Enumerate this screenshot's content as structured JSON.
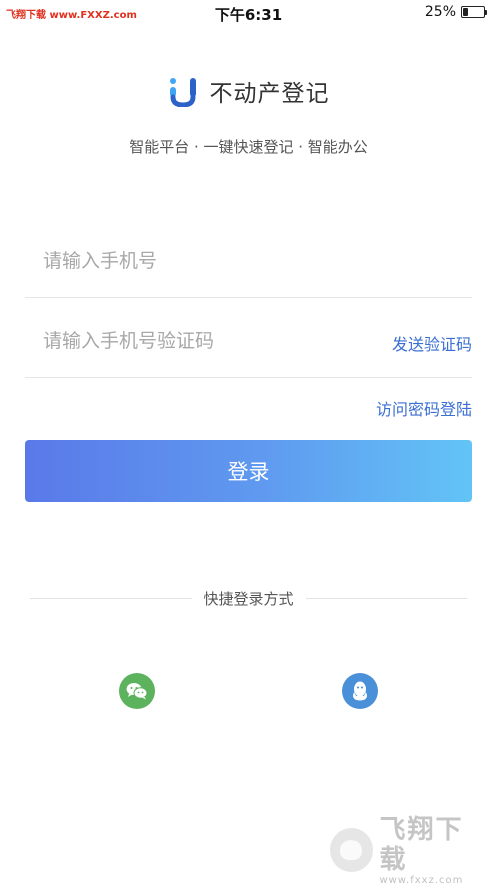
{
  "status_bar": {
    "watermark_text": "飞翔下载 www.FXXZ.com",
    "time": "下午6:31",
    "battery_percent": "25%",
    "battery_level": 0.25
  },
  "brand": {
    "title": "不动产登记",
    "logo_icon": "u-logo-icon",
    "logo_colors": [
      "#3ea6f2",
      "#2c61c7"
    ]
  },
  "tagline": "智能平台 · 一键快速登记 · 智能办公",
  "form": {
    "phone_placeholder": "请输入手机号",
    "phone_value": "",
    "code_placeholder": "请输入手机号验证码",
    "code_value": "",
    "send_code_label": "发送验证码",
    "password_login_label": "访问密码登陆",
    "login_button_label": "登录"
  },
  "quick_login": {
    "divider_label": "快捷登录方式",
    "options": [
      {
        "name": "wechat",
        "icon": "wechat-icon",
        "color": "#5cb25d"
      },
      {
        "name": "qq",
        "icon": "qq-icon",
        "color": "#4a90d9"
      }
    ]
  },
  "watermark": {
    "big_text": "飞翔下载",
    "small_text": "www.fxxz.com"
  },
  "colors": {
    "accent": "#3b6fd1",
    "button_gradient_start": "#5a79e9",
    "button_gradient_end": "#62c4f6"
  }
}
